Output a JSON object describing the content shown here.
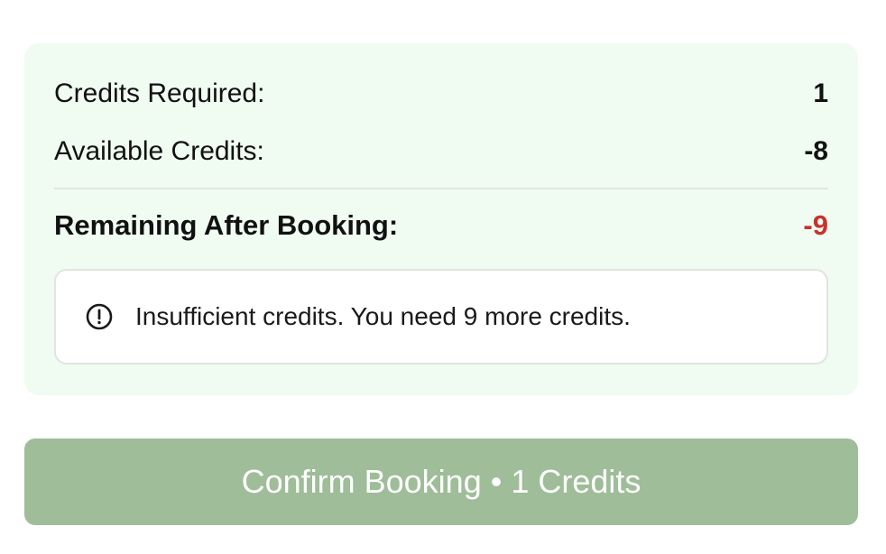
{
  "summary": {
    "credits_required_label": "Credits Required:",
    "credits_required_value": "1",
    "available_label": "Available Credits:",
    "available_value": "-8",
    "remaining_label": "Remaining After Booking:",
    "remaining_value": "-9",
    "remaining_color": "#c8322c",
    "background_color": "#f0fbf2"
  },
  "alert": {
    "icon": "alert-circle-icon",
    "message": "Insufficient credits. You need 9 more credits."
  },
  "confirm_button": {
    "label": "Confirm Booking • 1 Credits",
    "color": "#9ebd98",
    "state": "disabled"
  }
}
